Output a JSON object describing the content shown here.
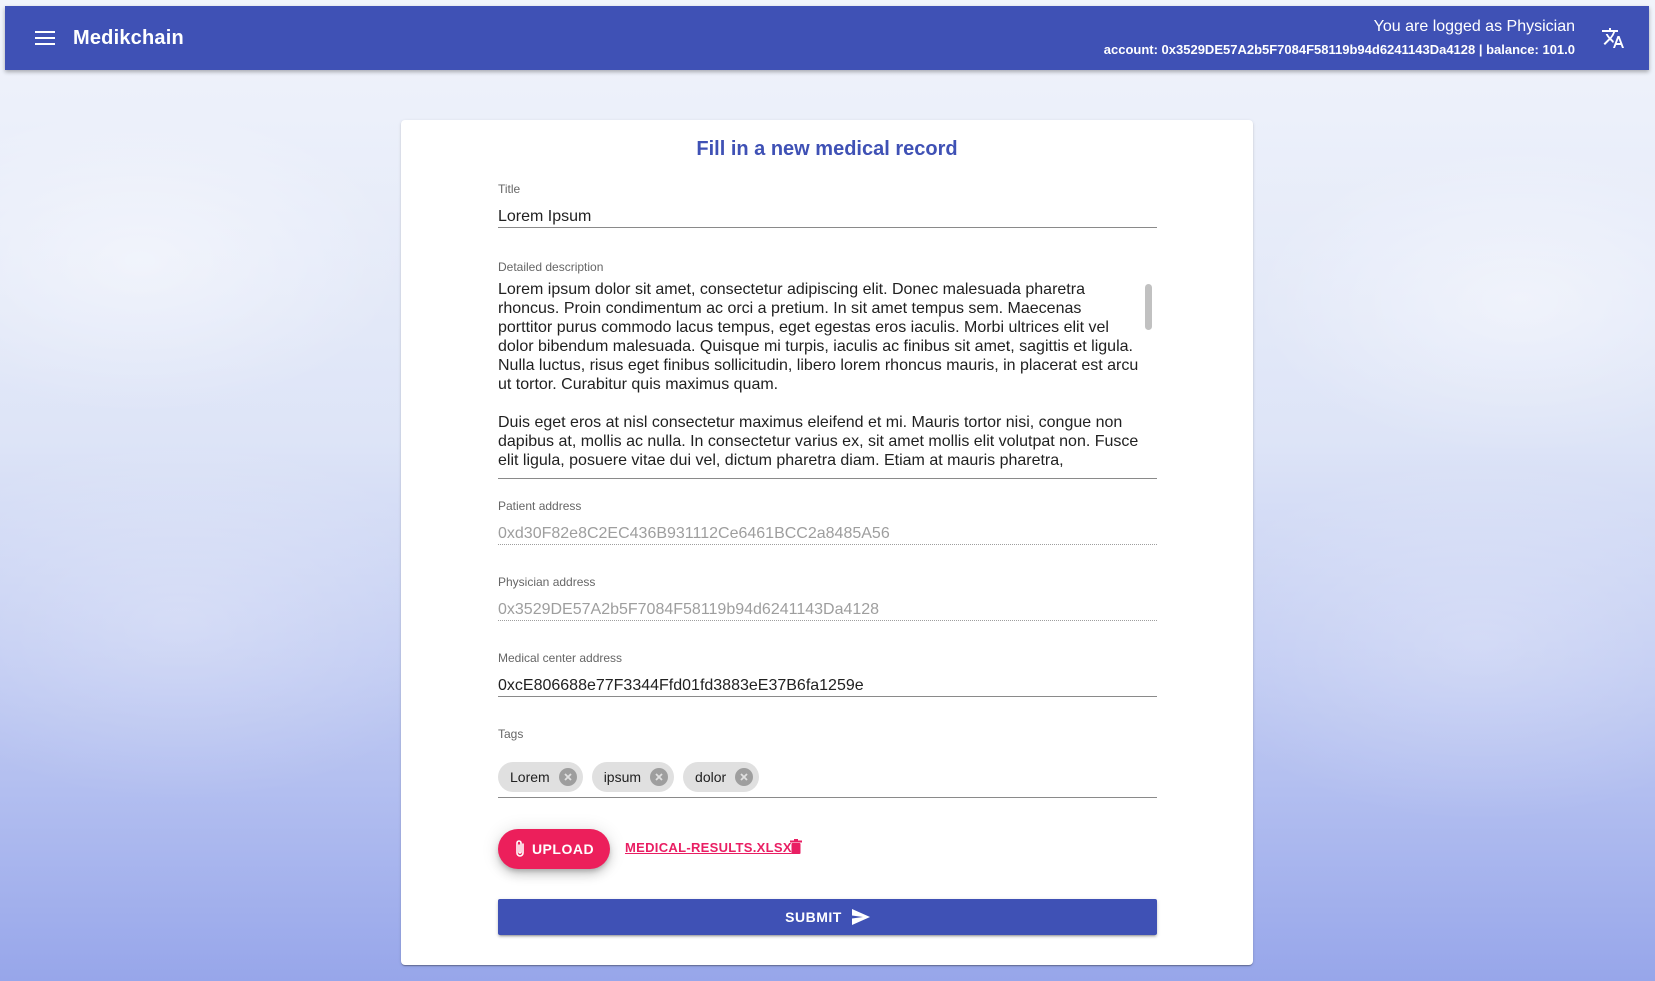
{
  "toolbar": {
    "app_title": "Medikchain",
    "user_role_text": "You are logged as Physician",
    "account_text": "account: 0x3529DE57A2b5F7084F58119b94d6241143Da4128 | balance: 101.0",
    "menu_icon": "menu-icon",
    "language_icon": "translate-icon"
  },
  "form": {
    "heading": "Fill in a new medical record",
    "title_label": "Title",
    "title_value": "Lorem Ipsum",
    "description_label": "Detailed description",
    "description_paragraphs": [
      "Lorem ipsum dolor sit amet, consectetur adipiscing elit. Donec malesuada pharetra rhoncus. Proin condimentum ac orci a pretium. In sit amet tempus sem. Maecenas porttitor purus commodo lacus tempus, eget egestas eros iaculis. Morbi ultrices elit vel dolor bibendum malesuada. Quisque mi turpis, iaculis ac finibus sit amet, sagittis et ligula. Nulla luctus, risus eget finibus sollicitudin, libero lorem rhoncus mauris, in placerat est arcu ut tortor. Curabitur quis maximus quam.",
      "Duis eget eros at nisl consectetur maximus eleifend et mi. Mauris tortor nisi, congue non dapibus at, mollis ac nulla. In consectetur varius ex, sit amet mollis elit volutpat non. Fusce elit ligula, posuere vitae dui vel, dictum pharetra diam. Etiam at mauris pharetra,"
    ],
    "patient_label": "Patient address",
    "patient_value": "0xd30F82e8C2EC436B931112Ce6461BCC2a8485A56",
    "physician_label": "Physician address",
    "physician_value": "0x3529DE57A2b5F7084F58119b94d6241143Da4128",
    "center_label": "Medical center address",
    "center_value": "0xcE806688e77F3344Ffd01fd3883eE37B6fa1259e",
    "tags_label": "Tags",
    "tags": [
      "Lorem",
      "ipsum",
      "dolor"
    ],
    "upload_label": "UPLOAD",
    "file_name": "MEDICAL-RESULTS.XLSX",
    "submit_label": "SUBMIT"
  },
  "colors": {
    "primary": "#3f51b5",
    "accent": "#ec1f5b"
  }
}
